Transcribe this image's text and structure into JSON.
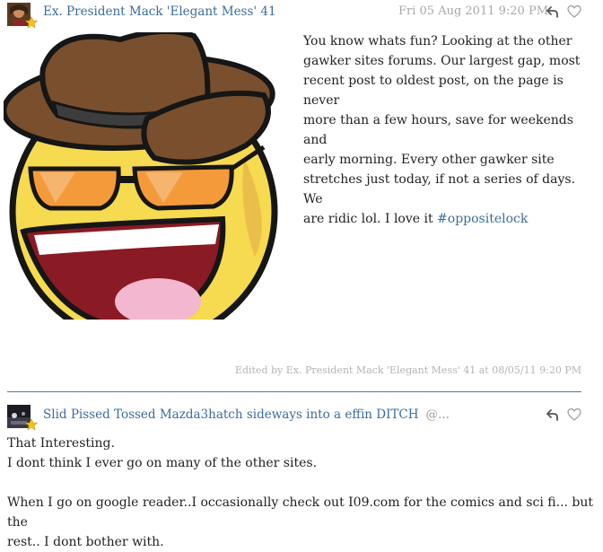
{
  "posts": [
    {
      "author": "Ex. President Mack 'Elegant Mess' 41",
      "timestamp": "Fri 05 Aug 2011 9:20 PM",
      "lines": [
        "You know whats fun? Looking at the other",
        "gawker sites forums. Our largest gap, most",
        "recent post to oldest post, on the page is never",
        "more than a few hours, save for weekends and",
        "early morning. Every other gawker site",
        "stretches just today, if not a series of days. We",
        "are ridic lol. I love it "
      ],
      "hashtag": "#oppositelock",
      "edited_note": "Edited by Ex. President Mack 'Elegant Mess' 41 at 08/05/11 9:20 PM",
      "image_icon": "awesome-face-with-fedora-icon"
    },
    {
      "author": "Slid Pissed Tossed Mazda3hatch sideways into a effin DITCH",
      "mention": "@...",
      "lines": [
        "That Interesting.",
        "I dont think I ever go on many of the other sites.",
        "",
        "When I go on google reader..I occasionally check out I09.com for the comics and sci fi... but the",
        "rest.. I dont bother with."
      ]
    }
  ],
  "colors": {
    "link": "#3d6b9c",
    "muted": "#a8a8a8",
    "divider": "#4b7aa8",
    "face_yellow": "#f6da4f",
    "hat_brown": "#7a4f2e"
  }
}
